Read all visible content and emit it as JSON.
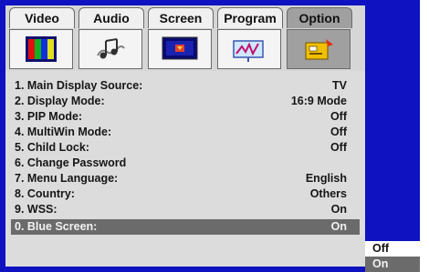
{
  "tabs": [
    {
      "label": "Video",
      "icon": "color-bars-icon",
      "active": false
    },
    {
      "label": "Audio",
      "icon": "music-notes-icon",
      "active": false
    },
    {
      "label": "Screen",
      "icon": "screen-icon",
      "active": false
    },
    {
      "label": "Program",
      "icon": "program-icon",
      "active": false
    },
    {
      "label": "Option",
      "icon": "option-icon",
      "active": true
    }
  ],
  "menu": [
    {
      "label": "1. Main Display Source:",
      "value": "TV"
    },
    {
      "label": "2. Display Mode:",
      "value": "16:9 Mode"
    },
    {
      "label": "3. PIP Mode:",
      "value": "Off"
    },
    {
      "label": "4. MultiWin Mode:",
      "value": "Off"
    },
    {
      "label": "5. Child Lock:",
      "value": "Off"
    },
    {
      "label": "6. Change Password",
      "value": ""
    },
    {
      "label": "7. Menu Language:",
      "value": "English"
    },
    {
      "label": "8. Country:",
      "value": "Others"
    },
    {
      "label": "9. WSS:",
      "value": "On"
    },
    {
      "label": "0. Blue Screen:",
      "value": "On"
    }
  ],
  "dropdown": {
    "options": [
      "Off",
      "On"
    ],
    "selected": "On"
  },
  "colors": {
    "frame": "#0e12c0",
    "panel": "#dcdcdc",
    "highlight": "#6b6b6b"
  }
}
